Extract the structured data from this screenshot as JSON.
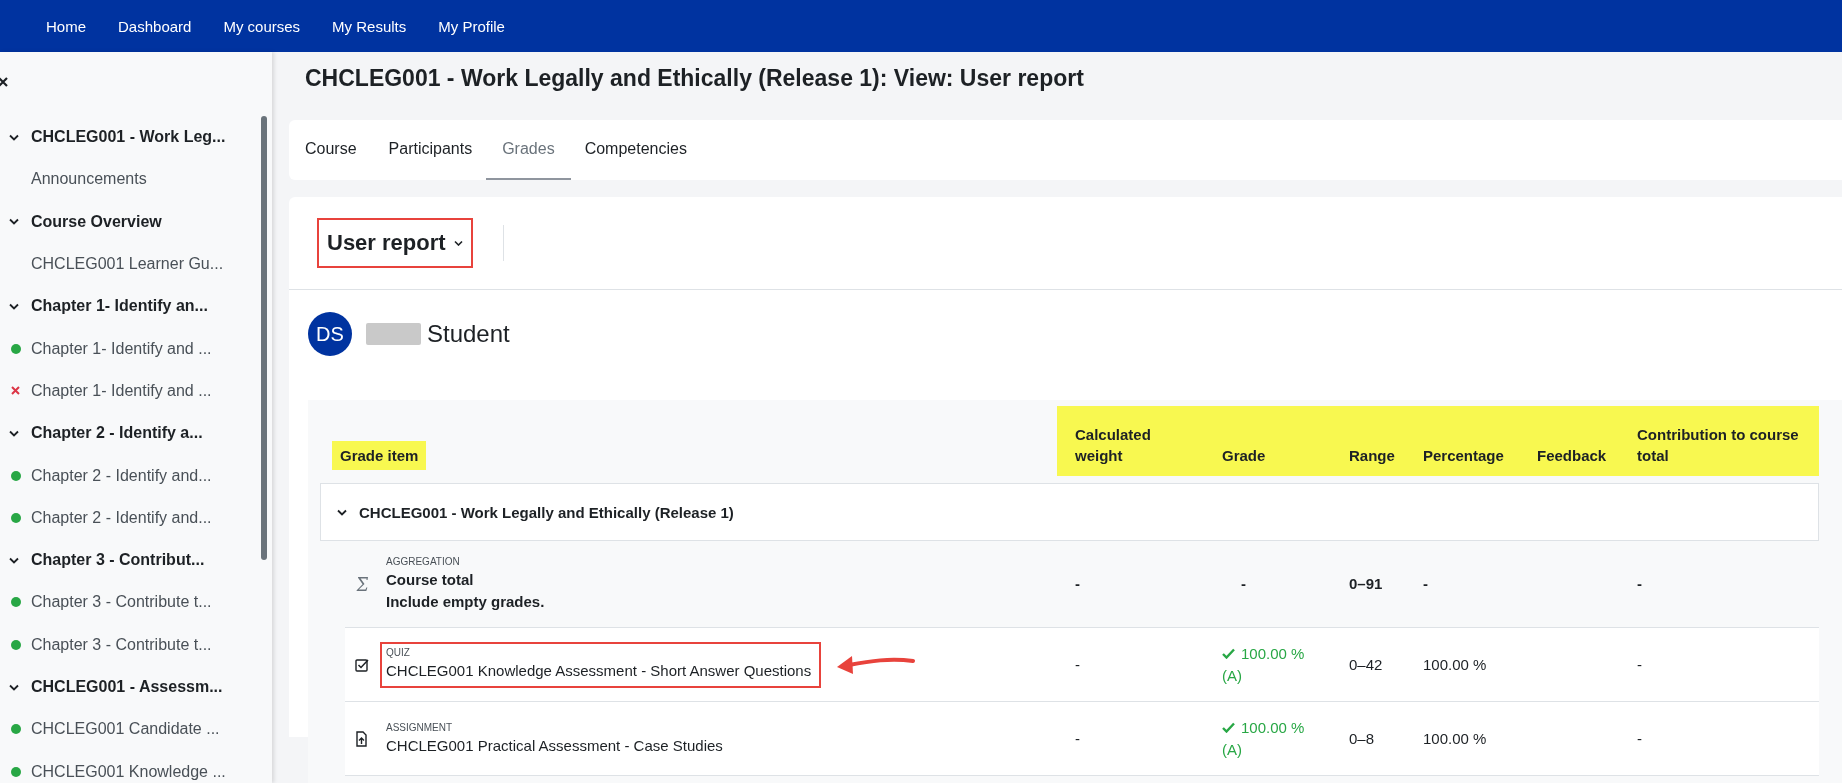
{
  "navbar": {
    "items": [
      {
        "label": "Home"
      },
      {
        "label": "Dashboard"
      },
      {
        "label": "My courses"
      },
      {
        "label": "My Results"
      },
      {
        "label": "My Profile"
      }
    ]
  },
  "sidebar": {
    "items": [
      {
        "label": "CHCLEG001 - Work Leg...",
        "expanded": true,
        "children": [
          {
            "label": "Announcements",
            "completed": false,
            "failed": false
          }
        ]
      },
      {
        "label": "Course Overview",
        "expanded": true,
        "children": [
          {
            "label": "CHCLEG001 Learner Gu...",
            "completed": false,
            "failed": false
          }
        ]
      },
      {
        "label": "Chapter 1- Identify an...",
        "expanded": true,
        "children": [
          {
            "label": "Chapter 1- Identify and ...",
            "completed": true,
            "failed": false
          },
          {
            "label": "Chapter 1- Identify and ...",
            "completed": false,
            "failed": true
          }
        ]
      },
      {
        "label": "Chapter 2 - Identify a...",
        "expanded": true,
        "children": [
          {
            "label": "Chapter 2 - Identify and...",
            "completed": true,
            "failed": false
          },
          {
            "label": "Chapter 2 - Identify and...",
            "completed": true,
            "failed": false
          }
        ]
      },
      {
        "label": "Chapter 3 - Contribut...",
        "expanded": true,
        "children": [
          {
            "label": "Chapter 3 - Contribute t...",
            "completed": true,
            "failed": false
          },
          {
            "label": "Chapter 3 - Contribute t...",
            "completed": true,
            "failed": false
          }
        ]
      },
      {
        "label": "CHCLEG001 - Assessm...",
        "expanded": true,
        "children": [
          {
            "label": "CHCLEG001 Candidate ...",
            "completed": true,
            "failed": false
          },
          {
            "label": "CHCLEG001 Knowledge ...",
            "completed": true,
            "failed": false
          }
        ]
      }
    ]
  },
  "page": {
    "title": "CHCLEG001 - Work Legally and Ethically (Release 1): View: User report"
  },
  "tabs": [
    {
      "label": "Course",
      "selected": false
    },
    {
      "label": "Participants",
      "selected": false
    },
    {
      "label": "Grades",
      "selected": true
    },
    {
      "label": "Competencies",
      "selected": false
    }
  ],
  "report_selector": {
    "label": "User report",
    "annotated": true
  },
  "user": {
    "initials": "DS",
    "name": "Student",
    "name_redacted": true
  },
  "table": {
    "columns": [
      {
        "label": "Grade item",
        "highlighted": true
      },
      {
        "label": "Calculated weight",
        "highlighted": true
      },
      {
        "label": "Grade",
        "highlighted": true
      },
      {
        "label": "Range",
        "highlighted": true
      },
      {
        "label": "Percentage",
        "highlighted": true
      },
      {
        "label": "Feedback",
        "highlighted": true
      },
      {
        "label": "Contribution to course total",
        "highlighted": true
      }
    ],
    "category": {
      "label": "CHCLEG001 - Work Legally and Ethically (Release 1)",
      "expanded": true
    },
    "rows": [
      {
        "kind": "aggregation",
        "type": "AGGREGATION",
        "name": "Course total",
        "note": "Include empty grades.",
        "weight": "-",
        "grade": "-",
        "range": "0–91",
        "percentage": "-",
        "contribution": "-",
        "annotated": false,
        "arrow": false
      },
      {
        "kind": "quiz",
        "type": "QUIZ",
        "name": "CHCLEG001 Knowledge Assessment - Short Answer Questions",
        "weight": "-",
        "grade": "100.00 %",
        "letter": "(A)",
        "passed": true,
        "range": "0–42",
        "percentage": "100.00 %",
        "contribution": "-",
        "annotated": true,
        "arrow": true
      },
      {
        "kind": "assignment",
        "type": "ASSIGNMENT",
        "name": "CHCLEG001 Practical Assessment - Case Studies",
        "weight": "-",
        "grade": "100.00 %",
        "letter": "(A)",
        "passed": true,
        "range": "0–8",
        "percentage": "100.00 %",
        "contribution": "-",
        "annotated": false,
        "arrow": false
      }
    ]
  }
}
